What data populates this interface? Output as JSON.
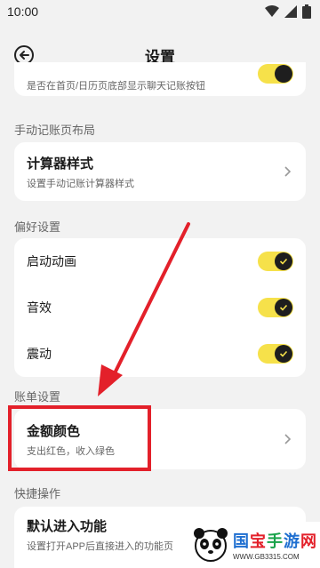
{
  "status_bar": {
    "time": "10:00"
  },
  "header": {
    "title": "设置"
  },
  "partial_row": {
    "subtitle": "是否在首页/日历页底部显示聊天记账按钮"
  },
  "sections": {
    "manual": {
      "label": "手动记账页布局",
      "calculator": {
        "title": "计算器样式",
        "subtitle": "设置手动记账计算器样式"
      }
    },
    "preferences": {
      "label": "偏好设置",
      "animation": {
        "title": "启动动画",
        "enabled": true
      },
      "sound": {
        "title": "音效",
        "enabled": true
      },
      "vibration": {
        "title": "震动",
        "enabled": true
      }
    },
    "bill": {
      "label": "账单设置",
      "amount_color": {
        "title": "金额颜色",
        "subtitle": "支出红色，收入绿色"
      }
    },
    "shortcuts": {
      "label": "快捷操作",
      "default_entry": {
        "title": "默认进入功能",
        "subtitle": "设置打开APP后直接进入的功能页"
      }
    }
  },
  "colors": {
    "toggle_on": "#f6e14a",
    "annotation": "#e3202a"
  },
  "watermark": {
    "brand": "国宝手游网",
    "url": "WWW.GB3315.COM"
  }
}
